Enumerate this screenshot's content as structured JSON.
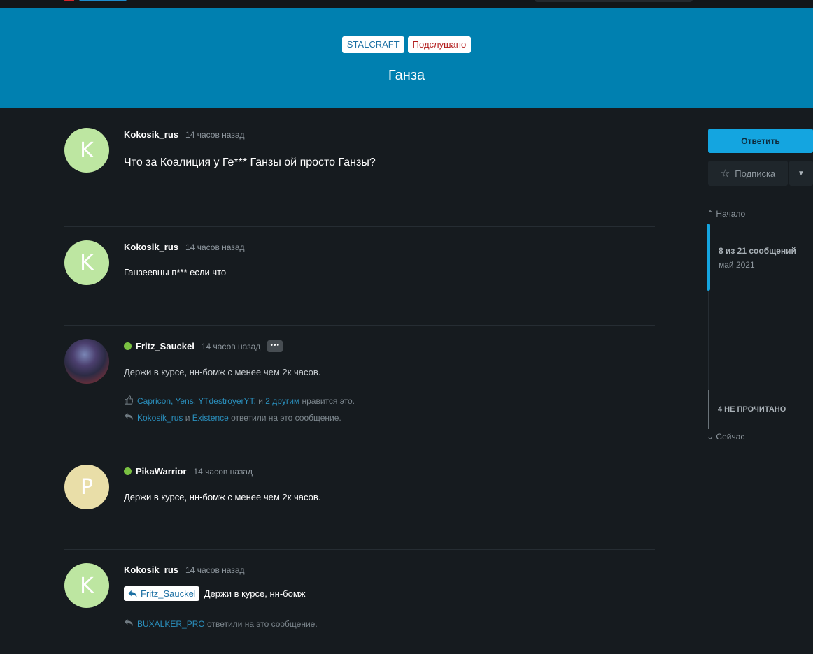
{
  "header": {
    "tags": [
      {
        "label": "STALCRAFT"
      },
      {
        "label": "Подслушано"
      }
    ],
    "title": "Ганза"
  },
  "posts": [
    {
      "avatar_letter": "K",
      "username": "Kokosik_rus",
      "time": "14 часов назад",
      "text": "Что за Коалиция у Ге*** Ганзы ой просто Ганзы?"
    },
    {
      "avatar_letter": "K",
      "username": "Kokosik_rus",
      "time": "14 часов назад",
      "text": "Ганзеевцы п*** если что"
    },
    {
      "username": "Fritz_Sauckel",
      "time": "14 часов назад",
      "more": "•••",
      "text": "Держи в курсе, нн-бомж с менее чем 2к часов.",
      "likes": {
        "users": "Capricon, Yens, YTdestroyerYT,",
        "joiner": "и",
        "others": "2 другим",
        "suffix": "нравится это."
      },
      "replies": {
        "user1": "Kokosik_rus",
        "joiner": "и",
        "user2": "Existence",
        "suffix": "ответили на это сообщение."
      }
    },
    {
      "avatar_letter": "P",
      "username": "PikaWarrior",
      "time": "14 часов назад",
      "text": "Держи в курсе, нн-бомж с менее чем 2к часов."
    },
    {
      "avatar_letter": "K",
      "username": "Kokosik_rus",
      "time": "14 часов назад",
      "quote_user": "Fritz_Sauckel",
      "text": "Держи в курсе, нн-бомж",
      "replies": {
        "user1": "BUXALKER_PRO",
        "suffix": "ответили на это сообщение."
      }
    }
  ],
  "sidebar": {
    "reply_label": "Ответить",
    "subscribe_label": "Подписка",
    "nav_start": "Начало",
    "position_label": "8 из 21 сообщений",
    "position_date": "май 2021",
    "unread_label": "4 НЕ ПРОЧИТАНО",
    "nav_now": "Сейчас"
  },
  "colors": {
    "header_bg": "#0080b0",
    "page_bg": "#161b1f",
    "accent": "#14a5e0",
    "online": "#7ac142",
    "link": "#2a8fbd"
  }
}
